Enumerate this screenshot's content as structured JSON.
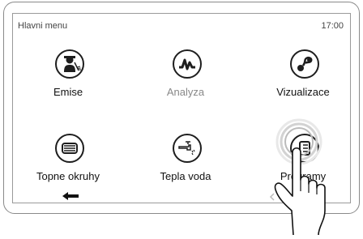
{
  "header": {
    "title": "Hlavni menu",
    "time": "17:00"
  },
  "menu": {
    "items": [
      {
        "label": "Emise",
        "icon": "chimney-sweep-icon",
        "enabled": true
      },
      {
        "label": "Analyza",
        "icon": "analysis-graph-icon",
        "enabled": false
      },
      {
        "label": "Vizualizace",
        "icon": "visualization-icon",
        "enabled": true
      },
      {
        "label": "Topne okruhy",
        "icon": "heating-circuits-icon",
        "enabled": true
      },
      {
        "label": "Tepla voda",
        "icon": "hot-water-tap-icon",
        "enabled": true
      },
      {
        "label": "Programy",
        "icon": "programs-icon",
        "enabled": true
      }
    ]
  },
  "nav": {
    "back_icon": "back-arrow-icon",
    "prev_icon": "chevron-left-icon"
  },
  "colors": {
    "icon_stroke": "#1e1e1e",
    "disabled_text": "#888888",
    "border": "#9a9a9a"
  }
}
